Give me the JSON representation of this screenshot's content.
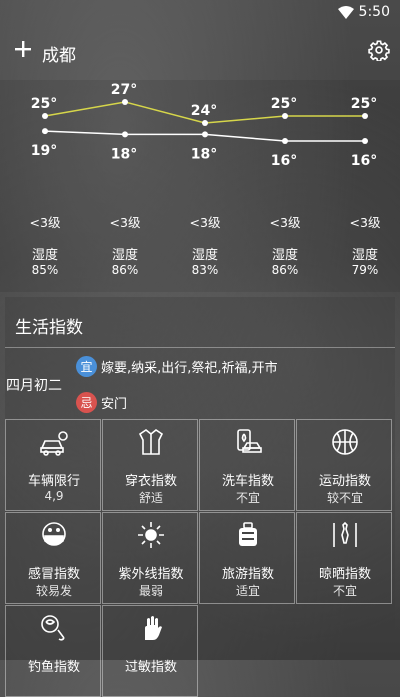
{
  "status": {
    "time": "5:50"
  },
  "header": {
    "city": "成都"
  },
  "forecast": {
    "high_temps": [
      "25°",
      "27°",
      "24°",
      "25°",
      "25°"
    ],
    "low_temps": [
      "19°",
      "18°",
      "18°",
      "16°",
      "16°"
    ],
    "high_values": [
      25,
      27,
      24,
      25,
      25
    ],
    "low_values": [
      19,
      18,
      18,
      16,
      16
    ],
    "wind": [
      "<3级",
      "<3级",
      "<3级",
      "<3级",
      "<3级"
    ],
    "humidity_label": "湿度",
    "humidity": [
      "85%",
      "86%",
      "83%",
      "86%",
      "79%"
    ],
    "colors": {
      "high_line": "#d6d64a",
      "low_line": "#ffffff"
    }
  },
  "life": {
    "title": "生活指数",
    "lunar_date": "四月初二",
    "yi": {
      "badge": "宜",
      "text": "嫁要,纳采,出行,祭祀,祈福,开市",
      "color": "#4a90d9"
    },
    "ji": {
      "badge": "忌",
      "text": "安门",
      "color": "#d9534f"
    },
    "items": [
      {
        "name": "车辆限行",
        "value": "4,9",
        "icon": "car-icon"
      },
      {
        "name": "穿衣指数",
        "value": "舒适",
        "icon": "jacket-icon"
      },
      {
        "name": "洗车指数",
        "value": "不宜",
        "icon": "car-wash-icon"
      },
      {
        "name": "运动指数",
        "value": "较不宜",
        "icon": "basketball-icon"
      },
      {
        "name": "感冒指数",
        "value": "较易发",
        "icon": "mask-face-icon"
      },
      {
        "name": "紫外线指数",
        "value": "最弱",
        "icon": "sun-icon"
      },
      {
        "name": "旅游指数",
        "value": "适宜",
        "icon": "suitcase-icon"
      },
      {
        "name": "晾晒指数",
        "value": "不宜",
        "icon": "drying-clothes-icon"
      },
      {
        "name": "钓鱼指数",
        "value": "",
        "icon": "fishing-icon"
      },
      {
        "name": "过敏指数",
        "value": "",
        "icon": "hand-icon"
      }
    ]
  }
}
